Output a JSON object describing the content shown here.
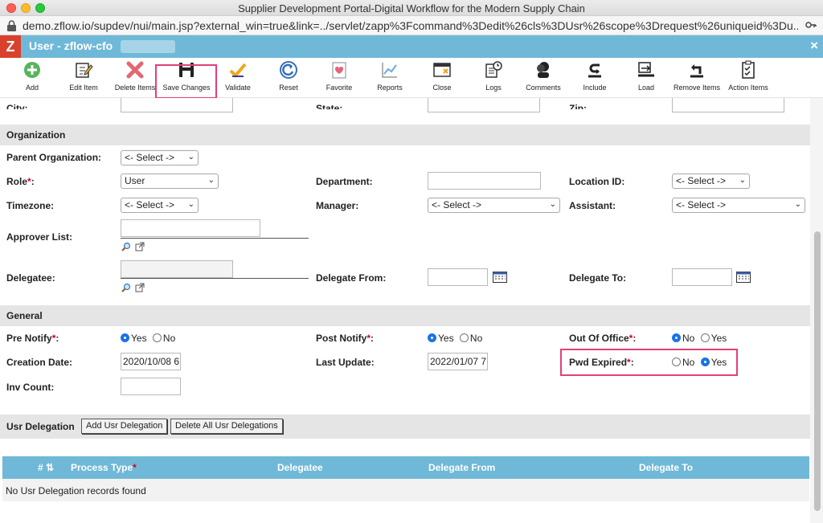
{
  "window": {
    "title": "Supplier Development Portal-Digital Workflow for the Modern Supply Chain"
  },
  "browser": {
    "url": "demo.zflow.io/supdev/nui/main.jsp?external_win=true&link=../servlet/zapp%3Fcommand%3Dedit%26cls%3DUsr%26scope%3Drequest%26uniqueid%3Du..."
  },
  "app": {
    "logo": "Z",
    "title": "User - zflow-cfo",
    "close": "×"
  },
  "toolbar": {
    "add": "Add",
    "edit_item": "Edit Item",
    "delete_items": "Delete Items",
    "save_changes": "Save Changes",
    "validate": "Validate",
    "reset": "Reset",
    "favorite": "Favorite",
    "reports": "Reports",
    "close": "Close",
    "logs": "Logs",
    "comments": "Comments",
    "include": "Include",
    "load": "Load",
    "remove_items": "Remove Items",
    "action_items": "Action Items"
  },
  "address": {
    "city": "City:",
    "state": "State:",
    "zip": "Zip:"
  },
  "organization": {
    "section": "Organization",
    "parent_org_label": "Parent Organization:",
    "parent_org_value": "<- Select ->",
    "role_label": "Role",
    "role_value": "User",
    "department_label": "Department:",
    "department_value": "",
    "location_label": "Location ID:",
    "location_value": "<- Select ->",
    "timezone_label": "Timezone:",
    "timezone_value": "<- Select ->",
    "manager_label": "Manager:",
    "manager_value": "<- Select ->",
    "assistant_label": "Assistant:",
    "assistant_value": "<- Select ->",
    "approver_label": "Approver List:",
    "delegatee_label": "Delegatee:",
    "delegate_from_label": "Delegate From:",
    "delegate_to_label": "Delegate To:"
  },
  "general": {
    "section": "General",
    "pre_notify_label": "Pre Notify",
    "post_notify_label": "Post Notify",
    "out_of_office_label": "Out Of Office",
    "yes": "Yes",
    "no": "No",
    "creation_date_label": "Creation Date:",
    "creation_date_value": "2020/10/08 6",
    "last_update_label": "Last Update:",
    "last_update_value": "2022/01/07 7",
    "pwd_expired_label": "Pwd Expired",
    "inv_count_label": "Inv Count:",
    "inv_count_value": ""
  },
  "delegation": {
    "section": "Usr Delegation",
    "add_button": "Add Usr Delegation",
    "delete_all_button": "Delete All Usr Delegations",
    "columns": [
      "#",
      "Process Type",
      "Delegatee",
      "Delegate From",
      "Delegate To"
    ],
    "empty_text": "No Usr Delegation records found"
  },
  "colors": {
    "header_blue": "#6fb8d8",
    "highlight_pink": "#e23f7a",
    "logo_red": "#d9412c"
  }
}
